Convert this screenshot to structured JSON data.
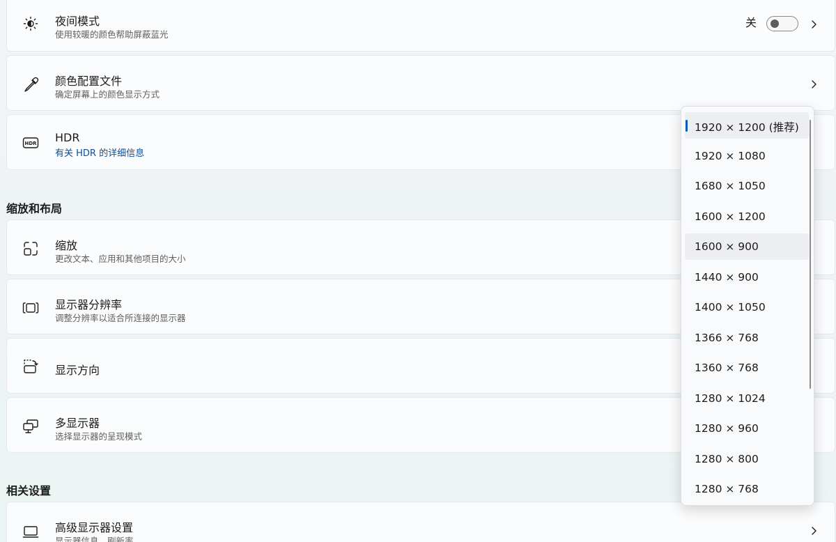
{
  "cards": {
    "night": {
      "title": "夜间模式",
      "subtitle": "使用较暖的颜色帮助屏蔽蓝光",
      "toggle_label": "关",
      "icon": "brightness-icon"
    },
    "color_profile": {
      "title": "颜色配置文件",
      "subtitle": "确定屏幕上的颜色显示方式",
      "icon": "eyedropper-icon"
    },
    "hdr": {
      "title": "HDR",
      "link": "有关 HDR 的详细信息",
      "icon": "hdr-icon",
      "icon_text": "HDR"
    },
    "scale": {
      "title": "缩放",
      "subtitle": "更改文本、应用和其他项目的大小",
      "icon": "scale-icon"
    },
    "resolution": {
      "title": "显示器分辨率",
      "subtitle": "调整分辨率以适合所连接的显示器",
      "icon": "resolution-icon"
    },
    "orientation": {
      "title": "显示方向",
      "icon": "rotate-screen-icon"
    },
    "multi": {
      "title": "多显示器",
      "subtitle": "选择显示器的呈现模式",
      "icon": "multiple-displays-icon"
    },
    "advanced": {
      "title": "高级显示器设置",
      "subtitle": "显示器信息，刷新率",
      "icon": "monitor-icon"
    }
  },
  "sections": {
    "scale_layout": "缩放和布局",
    "related": "相关设置"
  },
  "dropdown": {
    "selected": "1920 × 1200 (推荐)",
    "options": [
      "1920 × 1200 (推荐)",
      "1920 × 1080",
      "1680 × 1050",
      "1600 × 1200",
      "1600 × 900",
      "1440 × 900",
      "1400 × 1050",
      "1366 × 768",
      "1360 × 768",
      "1280 × 1024",
      "1280 × 960",
      "1280 × 800",
      "1280 × 768"
    ]
  },
  "colors": {
    "accent": "#0a5cb8",
    "link": "#0a4f96"
  }
}
